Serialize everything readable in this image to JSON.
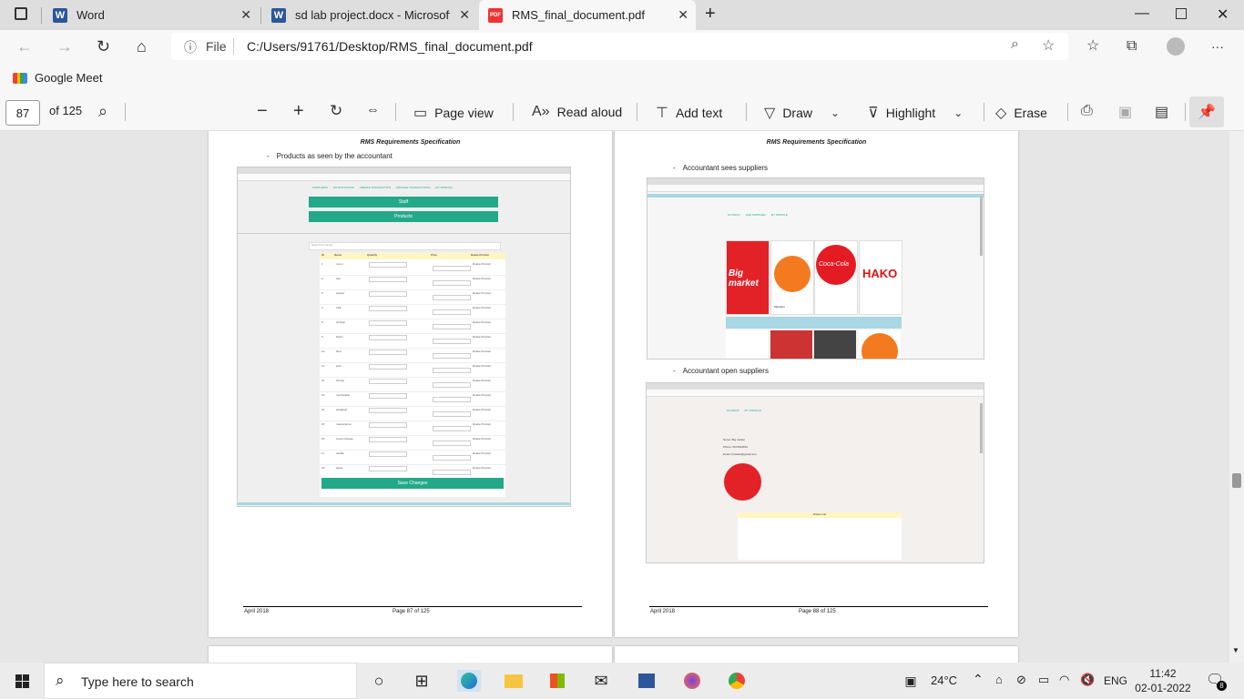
{
  "tabs": [
    {
      "title": "Word",
      "icon": "word-icon"
    },
    {
      "title": "sd lab project.docx - Microsoft W",
      "icon": "word-icon"
    },
    {
      "title": "RMS_final_document.pdf",
      "icon": "pdf-icon",
      "active": true
    }
  ],
  "address": {
    "scheme": "File",
    "url": "C:/Users/91761/Desktop/RMS_final_document.pdf"
  },
  "favorites": [
    {
      "label": "Google Meet",
      "icon": "google-meet-icon"
    }
  ],
  "pdf_toolbar": {
    "page_number": "87",
    "page_total": "of 125",
    "page_view": "Page view",
    "read_aloud": "Read aloud",
    "add_text": "Add text",
    "draw": "Draw",
    "highlight": "Highlight",
    "erase": "Erase"
  },
  "pages": [
    {
      "header": "RMS Requirements Specification",
      "bullet": "Products as seen by the accountant",
      "footer_left": "April 2018",
      "footer_center": "Page 87 of  125",
      "app": {
        "nav": [
          "SUPPLIERS",
          "NOTIFICATIONS",
          "CREATE TRANSACTION",
          "MANAGE TRANSACTIONS",
          "MY PROFILE"
        ],
        "staff_button": "Staff",
        "products_button": "Products",
        "search_placeholder": "Search for names",
        "columns": [
          "ID",
          "Name",
          "Quantity",
          "Price",
          "Delete Product"
        ],
        "rows": [
          [
            "1",
            "moon"
          ],
          [
            "2",
            "salt"
          ],
          [
            "3",
            "pepper"
          ],
          [
            "4",
            "milk"
          ],
          [
            "5",
            "chicken"
          ],
          [
            "6",
            "butter"
          ],
          [
            "10",
            "flour"
          ],
          [
            "11",
            "pork"
          ],
          [
            "12",
            "shrimp"
          ],
          [
            "13",
            "mozzarella"
          ],
          [
            "14",
            "spaghetti"
          ],
          [
            "15",
            "mascarpone"
          ],
          [
            "16",
            "cream cheese"
          ],
          [
            "17",
            "vanilla"
          ],
          [
            "18",
            "apple"
          ]
        ],
        "delete_label": "Delete Product",
        "save_button": "Save Changes"
      }
    },
    {
      "header": "RMS Requirements Specification",
      "bullet1": "Accountant sees suppliers",
      "bullet2": "Accountant open suppliers",
      "footer_left": "April 2018",
      "footer_center": "Page 88 of  125",
      "suppliers_nav": [
        "GO BACK",
        "ADD SUPPLIER",
        "MY PROFILE"
      ],
      "supplier_nav2": [
        "GO BACK",
        "MY PROFILE"
      ],
      "supplier_logos": [
        "Big market",
        "Mercator",
        "Coca-Cola",
        "HAKO"
      ],
      "supplier_detail": {
        "name": "Name: Big market",
        "phone": "Phone: 0674523651",
        "email": "Email: bmarket@gmail.com",
        "pricelist": "Prices List"
      }
    }
  ],
  "taskbar": {
    "search_placeholder": "Type here to search",
    "weather": "24°C",
    "language": "ENG",
    "time": "11:42",
    "date": "02-01-2022",
    "notifications": "8"
  },
  "colors": {
    "accent_green": "#23a98a",
    "pdf_red": "#e33333",
    "word_blue": "#2b579a"
  }
}
